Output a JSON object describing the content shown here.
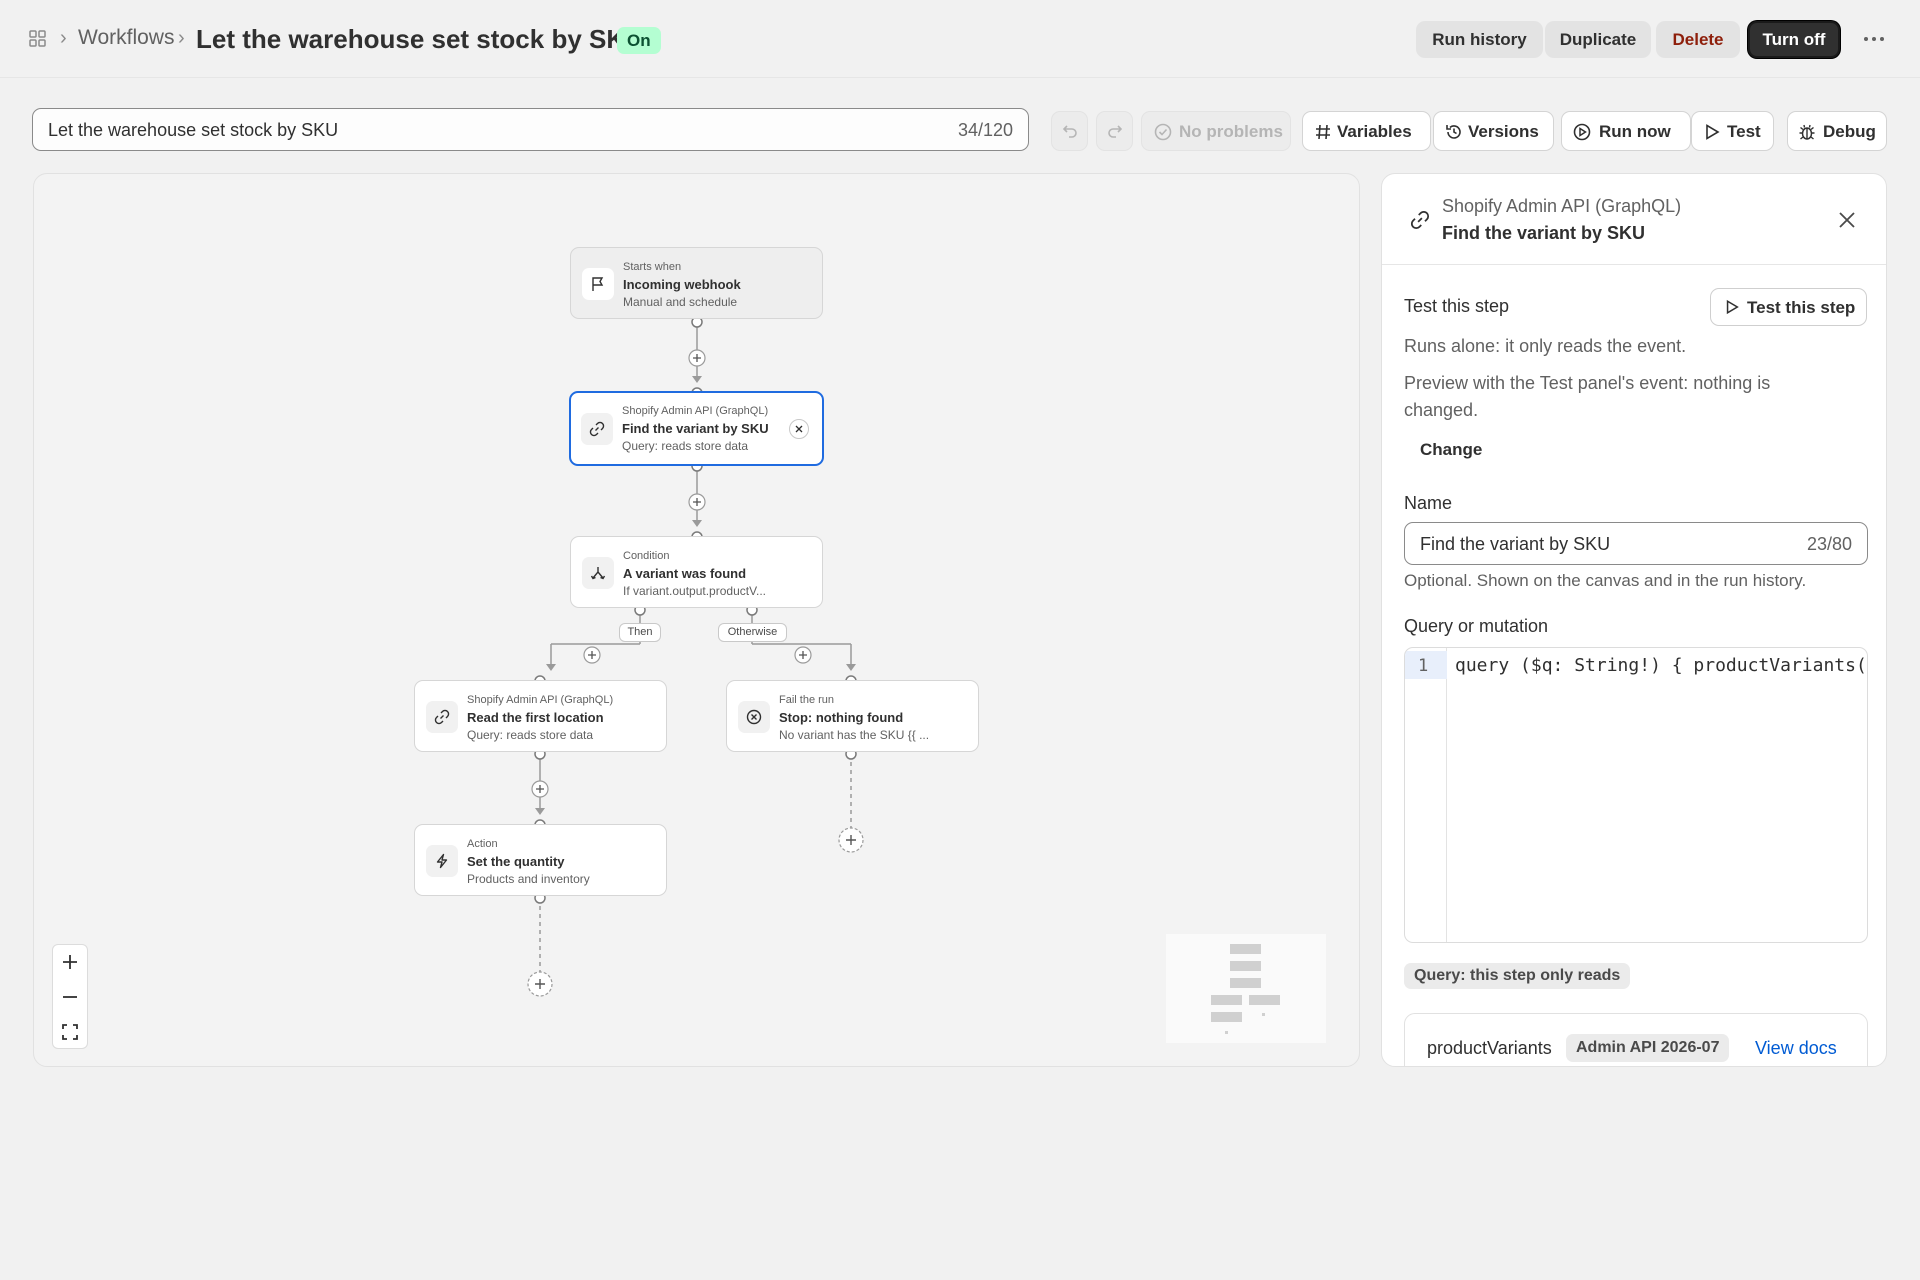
{
  "header": {
    "breadcrumb_parent": "Workflows",
    "title": "Let the warehouse set stock by SKU",
    "status": "On",
    "buttons": {
      "run_history": "Run history",
      "duplicate": "Duplicate",
      "delete": "Delete",
      "turn_off": "Turn off"
    }
  },
  "toolbar": {
    "name_value": "Let the warehouse set stock by SKU",
    "name_count": "34/120",
    "problems": "No problems",
    "variables": "Variables",
    "versions": "Versions",
    "run_now": "Run now",
    "test": "Test",
    "debug": "Debug"
  },
  "canvas": {
    "nodes": [
      {
        "kicker": "Starts when",
        "title": "Incoming webhook",
        "subtitle": "Manual and schedule",
        "icon": "flag-icon"
      },
      {
        "kicker": "Shopify Admin API (GraphQL)",
        "title": "Find the variant by SKU",
        "subtitle": "Query: reads store data",
        "icon": "link-icon",
        "selected": true
      },
      {
        "kicker": "Condition",
        "title": "A variant was found",
        "subtitle": "If variant.output.productV...",
        "icon": "branch-icon"
      },
      {
        "kicker": "Shopify Admin API (GraphQL)",
        "title": "Read the first location",
        "subtitle": "Query: reads store data",
        "icon": "link-icon"
      },
      {
        "kicker": "Fail the run",
        "title": "Stop: nothing found",
        "subtitle": "No variant has the SKU {{ ...",
        "icon": "x-circle-icon"
      },
      {
        "kicker": "Action",
        "title": "Set the quantity",
        "subtitle": "Products and inventory",
        "icon": "bolt-icon"
      }
    ],
    "branch_then": "Then",
    "branch_otherwise": "Otherwise"
  },
  "panel": {
    "kicker": "Shopify Admin API (GraphQL)",
    "title": "Find the variant by SKU",
    "test_heading": "Test this step",
    "test_button": "Test this step",
    "test_note_1": "Runs alone: it only reads the event.",
    "test_note_2": "Preview with the Test panel's event: nothing is changed.",
    "change": "Change",
    "name_label": "Name",
    "name_value": "Find the variant by SKU",
    "name_count": "23/80",
    "name_help": "Optional. Shown on the canvas and in the run history.",
    "query_label": "Query or mutation",
    "code_line_number": "1",
    "code_line": "query ($q: String!) { productVariants(f",
    "query_badge": "Query: this step only reads",
    "ref_operation": "productVariants",
    "ref_api_version": "Admin API 2026-07",
    "ref_docs": "View docs"
  },
  "colors": {
    "accent": "#1f6be0",
    "status_on_bg": "#b4fed2",
    "danger_text": "#8e1f0b",
    "link": "#005bd3"
  }
}
